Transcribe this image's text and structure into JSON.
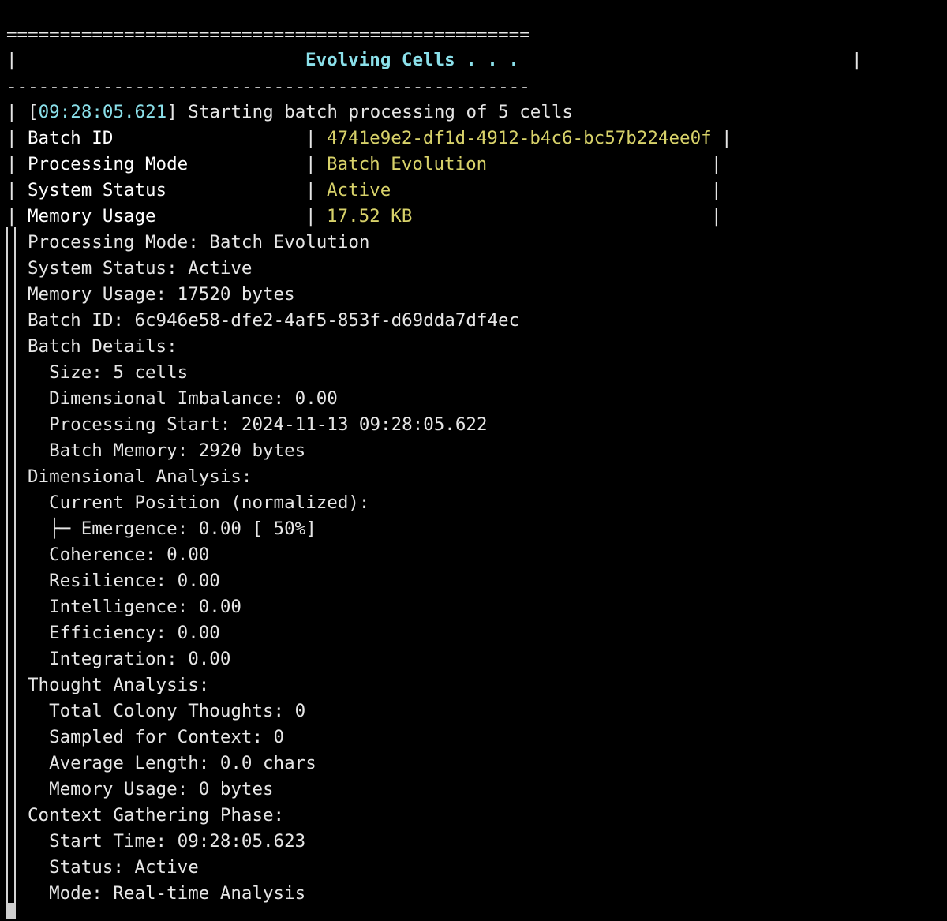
{
  "header": {
    "top_rule": "=====================================================",
    "title_bar_left": "|",
    "title": "Evolving Cells . . .",
    "title_bar_right": "|",
    "bottom_rule": "-----------------------------------------------------"
  },
  "log_line": {
    "prefix": "| [",
    "timestamp": "09:28:05.621",
    "suffix": "] Starting batch processing of 5 cells"
  },
  "info_table": {
    "rows": [
      {
        "lead": "|",
        "label": "Batch ID",
        "sep": "|",
        "value": "4741e9e2-df1d-4912-b4c6-bc57b224ee0f",
        "end": "|"
      },
      {
        "lead": "|",
        "label": "Processing Mode",
        "sep": "|",
        "value": "Batch Evolution",
        "end": "|"
      },
      {
        "lead": "|",
        "label": "System Status",
        "sep": "|",
        "value": "Active",
        "end": "|"
      },
      {
        "lead": "|",
        "label": "Memory Usage",
        "sep": "|",
        "value": "17.52 KB",
        "end": "|"
      }
    ]
  },
  "details": [
    "Processing Mode: Batch Evolution",
    "System Status: Active",
    "Memory Usage: 17520 bytes",
    "Batch ID: 6c946e58-dfe2-4af5-853f-d69dda7df4ec",
    "Batch Details:",
    "  Size: 5 cells",
    "  Dimensional Imbalance: 0.00",
    "  Processing Start: 2024-11-13 09:28:05.622",
    "  Batch Memory: 2920 bytes",
    "Dimensional Analysis:",
    "  Current Position (normalized):",
    "  ├─ Emergence: 0.00 [ 50%]",
    "  Coherence: 0.00",
    "  Resilience: 0.00",
    "  Intelligence: 0.00",
    "  Efficiency: 0.00",
    "  Integration: 0.00",
    "Thought Analysis:",
    "  Total Colony Thoughts: 0",
    "  Sampled for Context: 0",
    "  Average Length: 0.0 chars",
    "  Memory Usage: 0 bytes",
    "Context Gathering Phase:",
    "  Start Time: 09:28:05.623",
    "  Status: Active",
    "  Mode: Real-time Analysis"
  ],
  "colors": {
    "background": "#000000",
    "text": "#e6e6e6",
    "accent_cyan": "#8be0ea",
    "accent_yellow": "#d8d26a"
  }
}
